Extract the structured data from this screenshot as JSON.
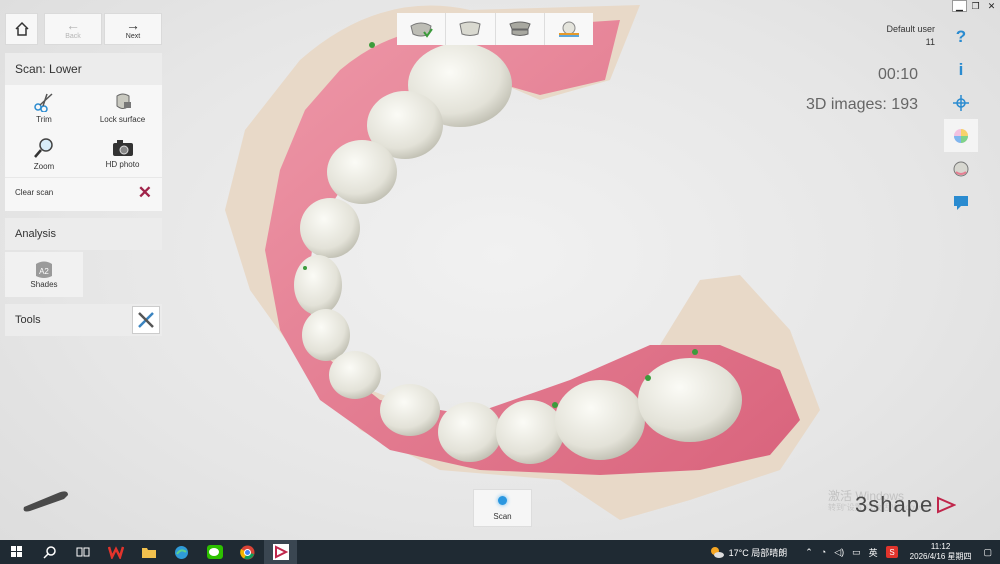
{
  "nav": {
    "home_icon": "home-icon",
    "back_label": "Back",
    "next_label": "Next"
  },
  "scan_panel": {
    "title": "Scan: Lower",
    "tools": [
      {
        "label": "Trim",
        "icon": "scissors-icon"
      },
      {
        "label": "Lock surface",
        "icon": "lock-surface-icon"
      },
      {
        "label": "Zoom",
        "icon": "magnifier-icon"
      },
      {
        "label": "HD photo",
        "icon": "camera-icon"
      }
    ],
    "clear_label": "Clear scan"
  },
  "analysis": {
    "title": "Analysis",
    "shades_label": "Shades",
    "shades_badge": "A2"
  },
  "tools_panel": {
    "title": "Tools"
  },
  "workflow": {
    "steps": [
      "upper-jaw-step-icon",
      "lower-jaw-step-icon",
      "bite-step-icon",
      "post-process-step-icon"
    ]
  },
  "user": {
    "name": "Default user",
    "count": "11"
  },
  "status": {
    "timer": "00:10",
    "images": "3D images: 193"
  },
  "right_toolbar": {
    "help": "?",
    "info": "i"
  },
  "scan_button": {
    "label": "Scan"
  },
  "watermark": {
    "line1": "激活 Windows",
    "line2": "转到“设置”以激活 Windows。"
  },
  "brand": {
    "name": "3shape"
  },
  "taskbar": {
    "weather": "17°C 局部晴朗",
    "ime": "英",
    "time": "11:12",
    "date": "2026/4/16 星期四"
  },
  "colors": {
    "accent": "#2a8bd0",
    "gum": "#e67f93",
    "tooth": "#e9e8e0",
    "delete": "#a0244a",
    "taskbar": "#1f2a33"
  }
}
